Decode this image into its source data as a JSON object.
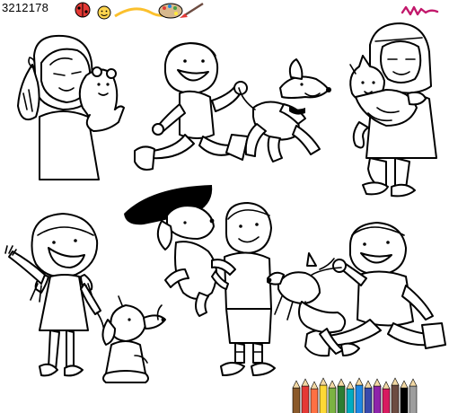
{
  "stock_id": "3212178",
  "colors": {
    "line": "#000000",
    "paper": "#ffffff",
    "brush_magenta": "#c2186b",
    "palette_colors": [
      "#e53935",
      "#ffb300",
      "#ffeb3b",
      "#43a047",
      "#1e88e5",
      "#8e24aa"
    ],
    "pencils": [
      "#8b5a2b",
      "#e53935",
      "#ff7043",
      "#fdd835",
      "#7cb342",
      "#2e7d32",
      "#00acc1",
      "#1e88e5",
      "#3949ab",
      "#8e24aa",
      "#d81b60",
      "#6d4c41",
      "#000000",
      "#9e9e9e"
    ]
  },
  "scenes": [
    {
      "id": "girl-with-hamster",
      "icon": "girl-hamster-illustration"
    },
    {
      "id": "boy-running-with-dog",
      "icon": "boy-dog-running-illustration"
    },
    {
      "id": "girl-with-cat",
      "icon": "girl-cat-illustration"
    },
    {
      "id": "girl-walking-puppy",
      "icon": "girl-puppy-illustration"
    },
    {
      "id": "boy-carrying-dog",
      "icon": "boy-carrying-dog-illustration"
    },
    {
      "id": "boy-walking-dog",
      "icon": "boy-walking-dog-illustration"
    }
  ]
}
